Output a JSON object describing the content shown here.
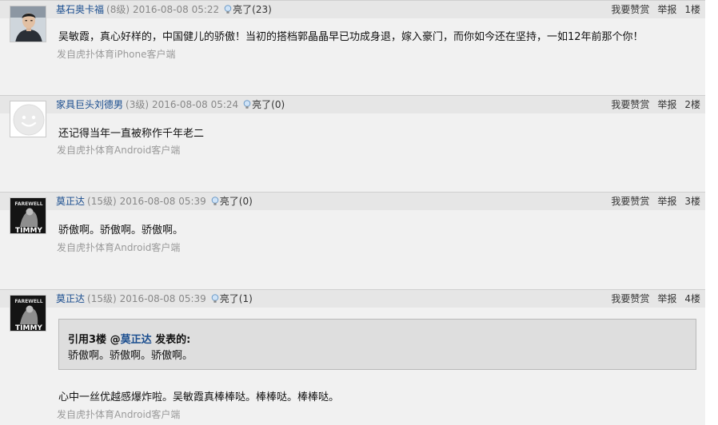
{
  "posts": [
    {
      "author": "基石奥卡福",
      "level": "(8级)",
      "time": "2016-08-08 05:22",
      "light": "亮了(23)",
      "content": "吴敏霞，真心好样的，中国健儿的骄傲！当初的搭档郭晶晶早已功成身退，嫁入豪门，而你如今还在坚持，一如12年前那个你！",
      "source": "发自虎扑体育iPhone客户端",
      "reward": "我要赞赏",
      "report": "举报",
      "floor": "1楼"
    },
    {
      "author": "家具巨头刘德男",
      "level": "(3级)",
      "time": "2016-08-08 05:24",
      "light": "亮了(0)",
      "content": "还记得当年一直被称作千年老二",
      "source": "发自虎扑体育Android客户端",
      "reward": "我要赞赏",
      "report": "举报",
      "floor": "2楼"
    },
    {
      "author": "莫正达",
      "level": "(15级)",
      "time": "2016-08-08 05:39",
      "light": "亮了(0)",
      "content": "骄傲啊。骄傲啊。骄傲啊。",
      "source": "发自虎扑体育Android客户端",
      "reward": "我要赞赏",
      "report": "举报",
      "floor": "3楼",
      "avatar_text_top": "FAREWELL",
      "avatar_text_bottom": "TIMMY"
    },
    {
      "author": "莫正达",
      "level": "(15级)",
      "time": "2016-08-08 05:39",
      "light": "亮了(1)",
      "quote": {
        "prefix": "引用3楼 @",
        "author": "莫正达",
        "suffix": " 发表的:",
        "body": "骄傲啊。骄傲啊。骄傲啊。"
      },
      "content": "心中一丝优越感爆炸啦。吴敏霞真棒棒哒。棒棒哒。棒棒哒。",
      "source": "发自虎扑体育Android客户端",
      "reward": "我要赞赏",
      "report": "举报",
      "floor": "4楼",
      "avatar_text_top": "FAREWELL",
      "avatar_text_bottom": "TIMMY"
    }
  ],
  "colors": {
    "author_link": "#1a4d8f",
    "background": "#f1f1f1",
    "header_bar": "#e6e6e6",
    "quote_background": "#dedede"
  }
}
